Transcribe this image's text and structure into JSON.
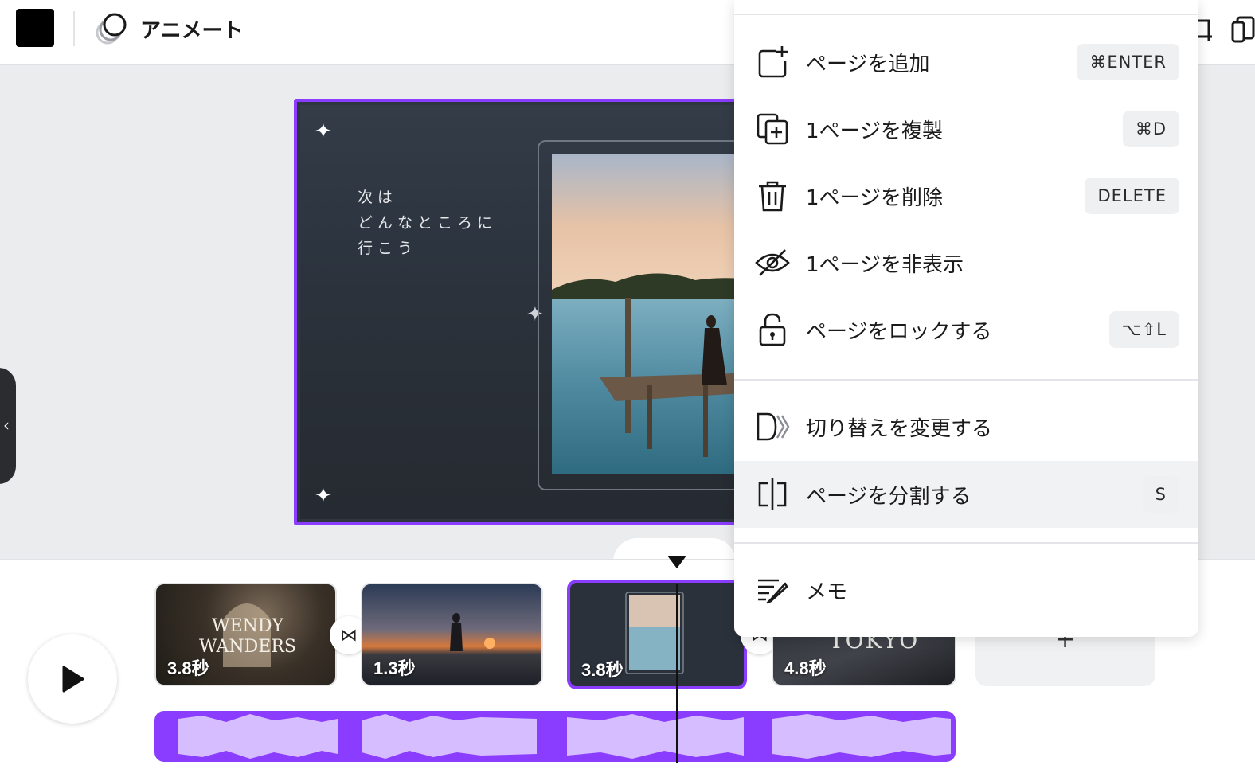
{
  "toolbar": {
    "swatch_color": "#000000",
    "animate_label": "アニメート"
  },
  "canvas": {
    "slide_text": [
      "次は",
      "どんなところに",
      "行こう"
    ],
    "selection_color": "#8b3dff"
  },
  "timeline": {
    "clips": [
      {
        "duration": "3.8秒",
        "title_lines": [
          "WENDY",
          "WANDERS"
        ]
      },
      {
        "duration": "1.3秒"
      },
      {
        "duration": "3.8秒",
        "selected": true
      },
      {
        "duration": "4.8秒",
        "title": "TOKYO"
      }
    ],
    "add_page_symbol": "+"
  },
  "context_menu": {
    "items": [
      {
        "label": "ページを追加",
        "shortcut": "⌘ENTER",
        "icon": "add-page-icon"
      },
      {
        "label": "1ページを複製",
        "shortcut": "⌘D",
        "icon": "duplicate-page-icon"
      },
      {
        "label": "1ページを削除",
        "shortcut": "DELETE",
        "icon": "trash-icon"
      },
      {
        "label": "1ページを非表示",
        "shortcut": "",
        "icon": "eye-hidden-icon"
      },
      {
        "label": "ページをロックする",
        "shortcut": "⌥⇧L",
        "icon": "lock-icon"
      },
      {
        "label": "切り替えを変更する",
        "shortcut": "",
        "icon": "transition-icon"
      },
      {
        "label": "ページを分割する",
        "shortcut": "S",
        "icon": "split-page-icon",
        "active": true
      },
      {
        "label": "メモ",
        "shortcut": "",
        "icon": "notes-icon"
      }
    ]
  }
}
